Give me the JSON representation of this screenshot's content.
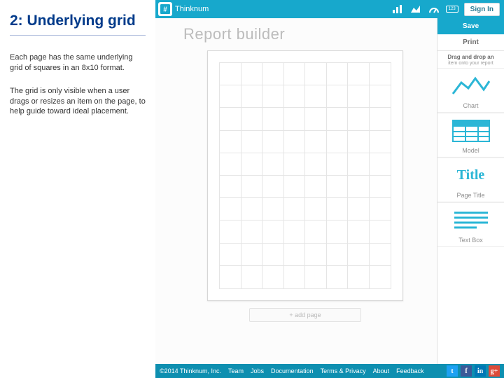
{
  "slide": {
    "title": "2: Underlying grid",
    "para1": "Each page has the same underlying grid of squares in an 8x10 format.",
    "para2": "The grid is only visible when a user drags or resizes an item on the page, to help guide toward ideal placement."
  },
  "topbar": {
    "brand": "Thinknum",
    "nav_count_badge": "123",
    "signin": "Sign In"
  },
  "builder": {
    "title": "Report builder",
    "add_page": "+ add page"
  },
  "sidebar": {
    "save": "Save",
    "print": "Print",
    "hint_bold": "Drag and drop an",
    "hint_small": "item onto your report",
    "widgets": [
      {
        "label": "Chart"
      },
      {
        "label": "Model"
      },
      {
        "label": "Page Title",
        "big": "Title"
      },
      {
        "label": "Text Box"
      }
    ]
  },
  "footer": {
    "copyright": "©2014 Thinknum, Inc.",
    "links": [
      "Team",
      "Jobs",
      "Documentation",
      "Terms & Privacy",
      "About",
      "Feedback"
    ]
  }
}
